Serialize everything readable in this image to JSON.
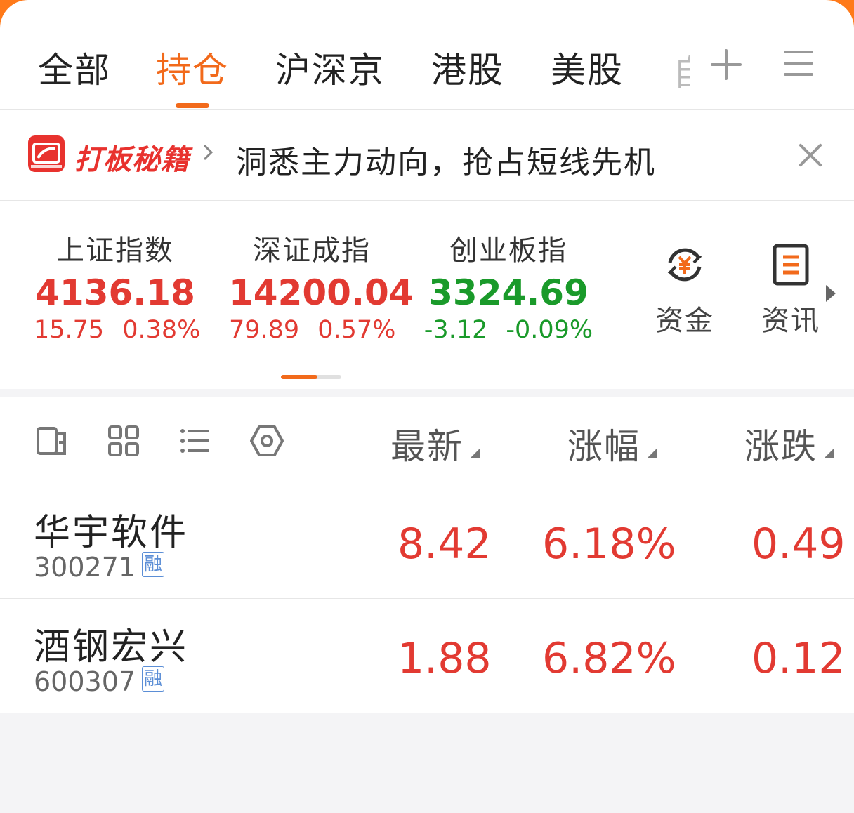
{
  "tabs": [
    {
      "label": "全部"
    },
    {
      "label": "持仓"
    },
    {
      "label": "沪深京"
    },
    {
      "label": "港股"
    },
    {
      "label": "美股"
    },
    {
      "label": "自"
    }
  ],
  "active_tab": "持仓",
  "banner": {
    "brand": "打板秘籍",
    "text": "洞悉主力动向，抢占短线先机"
  },
  "indices": [
    {
      "name": "上证指数",
      "value": "4136.18",
      "change": "15.75",
      "pct": "0.38%",
      "trend": "up"
    },
    {
      "name": "深证成指",
      "value": "14200.04",
      "change": "79.89",
      "pct": "0.57%",
      "trend": "up"
    },
    {
      "name": "创业板指",
      "value": "3324.69",
      "change": "-3.12",
      "pct": "-0.09%",
      "trend": "down"
    }
  ],
  "side_buttons": [
    {
      "label": "资金",
      "icon": "yuan-flow-icon"
    },
    {
      "label": "资讯",
      "icon": "news-doc-icon"
    }
  ],
  "columns": {
    "latest": "最新",
    "change_pct": "涨幅",
    "change": "涨跌"
  },
  "stocks": [
    {
      "name": "华宇软件",
      "code": "300271",
      "tag": "融",
      "latest": "8.42",
      "change_pct": "6.18%",
      "change": "0.49"
    },
    {
      "name": "酒钢宏兴",
      "code": "600307",
      "tag": "融",
      "latest": "1.88",
      "change_pct": "6.82%",
      "change": "0.12"
    }
  ],
  "colors": {
    "accent": "#f26a1b",
    "up": "#e23a32",
    "down": "#1a9a2a"
  }
}
